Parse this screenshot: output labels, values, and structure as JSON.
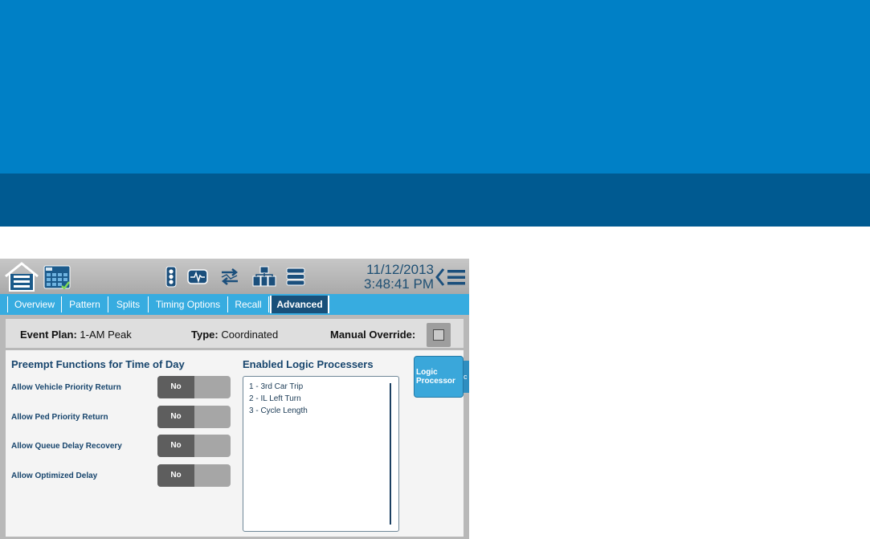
{
  "colors": {
    "banner_top": "#0080c6",
    "banner_bottom": "#005a91",
    "tabbar": "#37ace0",
    "active_tab": "#18507a",
    "label_text": "#17456d"
  },
  "topbar": {
    "date": "11/12/2013",
    "time": "3:48:41 PM",
    "icons": [
      "home-menu-icon",
      "controller-grid-icon",
      "signal-head-icon",
      "waveform-icon",
      "coordination-arrows-icon",
      "network-icon",
      "list-icon",
      "back-chevron-menu-icon"
    ]
  },
  "tabs": [
    {
      "label": "Overview",
      "active": false
    },
    {
      "label": "Pattern",
      "active": false
    },
    {
      "label": "Splits",
      "active": false
    },
    {
      "label": "Timing Options",
      "active": false
    },
    {
      "label": "Recall",
      "active": false
    },
    {
      "label": "Advanced",
      "active": true
    }
  ],
  "infobar": {
    "event_plan_label": "Event Plan:",
    "event_plan_value": "1-AM Peak",
    "type_label": "Type:",
    "type_value": "Coordinated",
    "manual_override_label": "Manual Override:",
    "manual_override_checked": false
  },
  "preempt": {
    "title": "Preempt Functions for Time of Day",
    "rows": [
      {
        "label": "Allow Vehicle Priority Return",
        "value": "No"
      },
      {
        "label": "Allow Ped Priority Return",
        "value": "No"
      },
      {
        "label": "Allow Queue Delay Recovery",
        "value": "No"
      },
      {
        "label": "Allow Optimized Delay",
        "value": "No"
      }
    ]
  },
  "logic": {
    "title": "Enabled Logic Processers",
    "items": [
      "1 - 3rd Car Trip",
      "2 - IL Left Turn",
      "3 - Cycle Length"
    ],
    "button_line1": "Logic",
    "button_line2": "Processor",
    "side_tab": "c"
  }
}
